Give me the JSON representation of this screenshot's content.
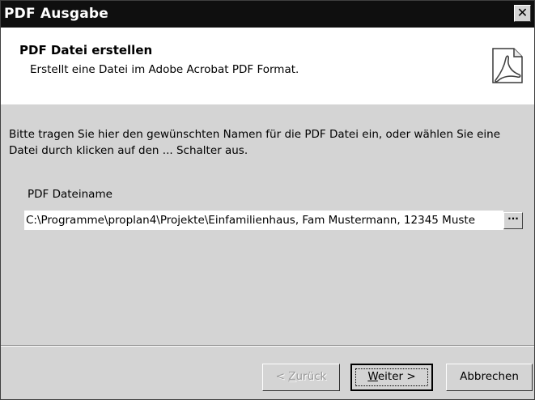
{
  "window": {
    "title": "PDF Ausgabe",
    "close_glyph": "✕"
  },
  "header": {
    "title": "PDF Datei erstellen",
    "subtitle": "Erstellt eine Datei im Adobe Acrobat PDF Format.",
    "icon": "acrobat-document-icon"
  },
  "body": {
    "instructions": "Bitte tragen Sie hier den gewünschten Namen für die PDF Datei ein, oder wählen Sie eine Datei durch klicken auf den ... Schalter aus.",
    "field_label": "PDF Dateiname",
    "path_value": "C:\\Programme\\proplan4\\Projekte\\Einfamilienhaus, Fam Mustermann, 12345 Muste",
    "browse_label": "···"
  },
  "buttons": {
    "back_prefix": "< ",
    "back_mnemonic": "Z",
    "back_rest": "urück",
    "next_mnemonic": "W",
    "next_rest": "eiter >",
    "cancel": "Abbrechen"
  },
  "colors": {
    "titlebar": "#0f0f0f",
    "dialog": "#d4d4d4",
    "header": "#ffffff"
  }
}
